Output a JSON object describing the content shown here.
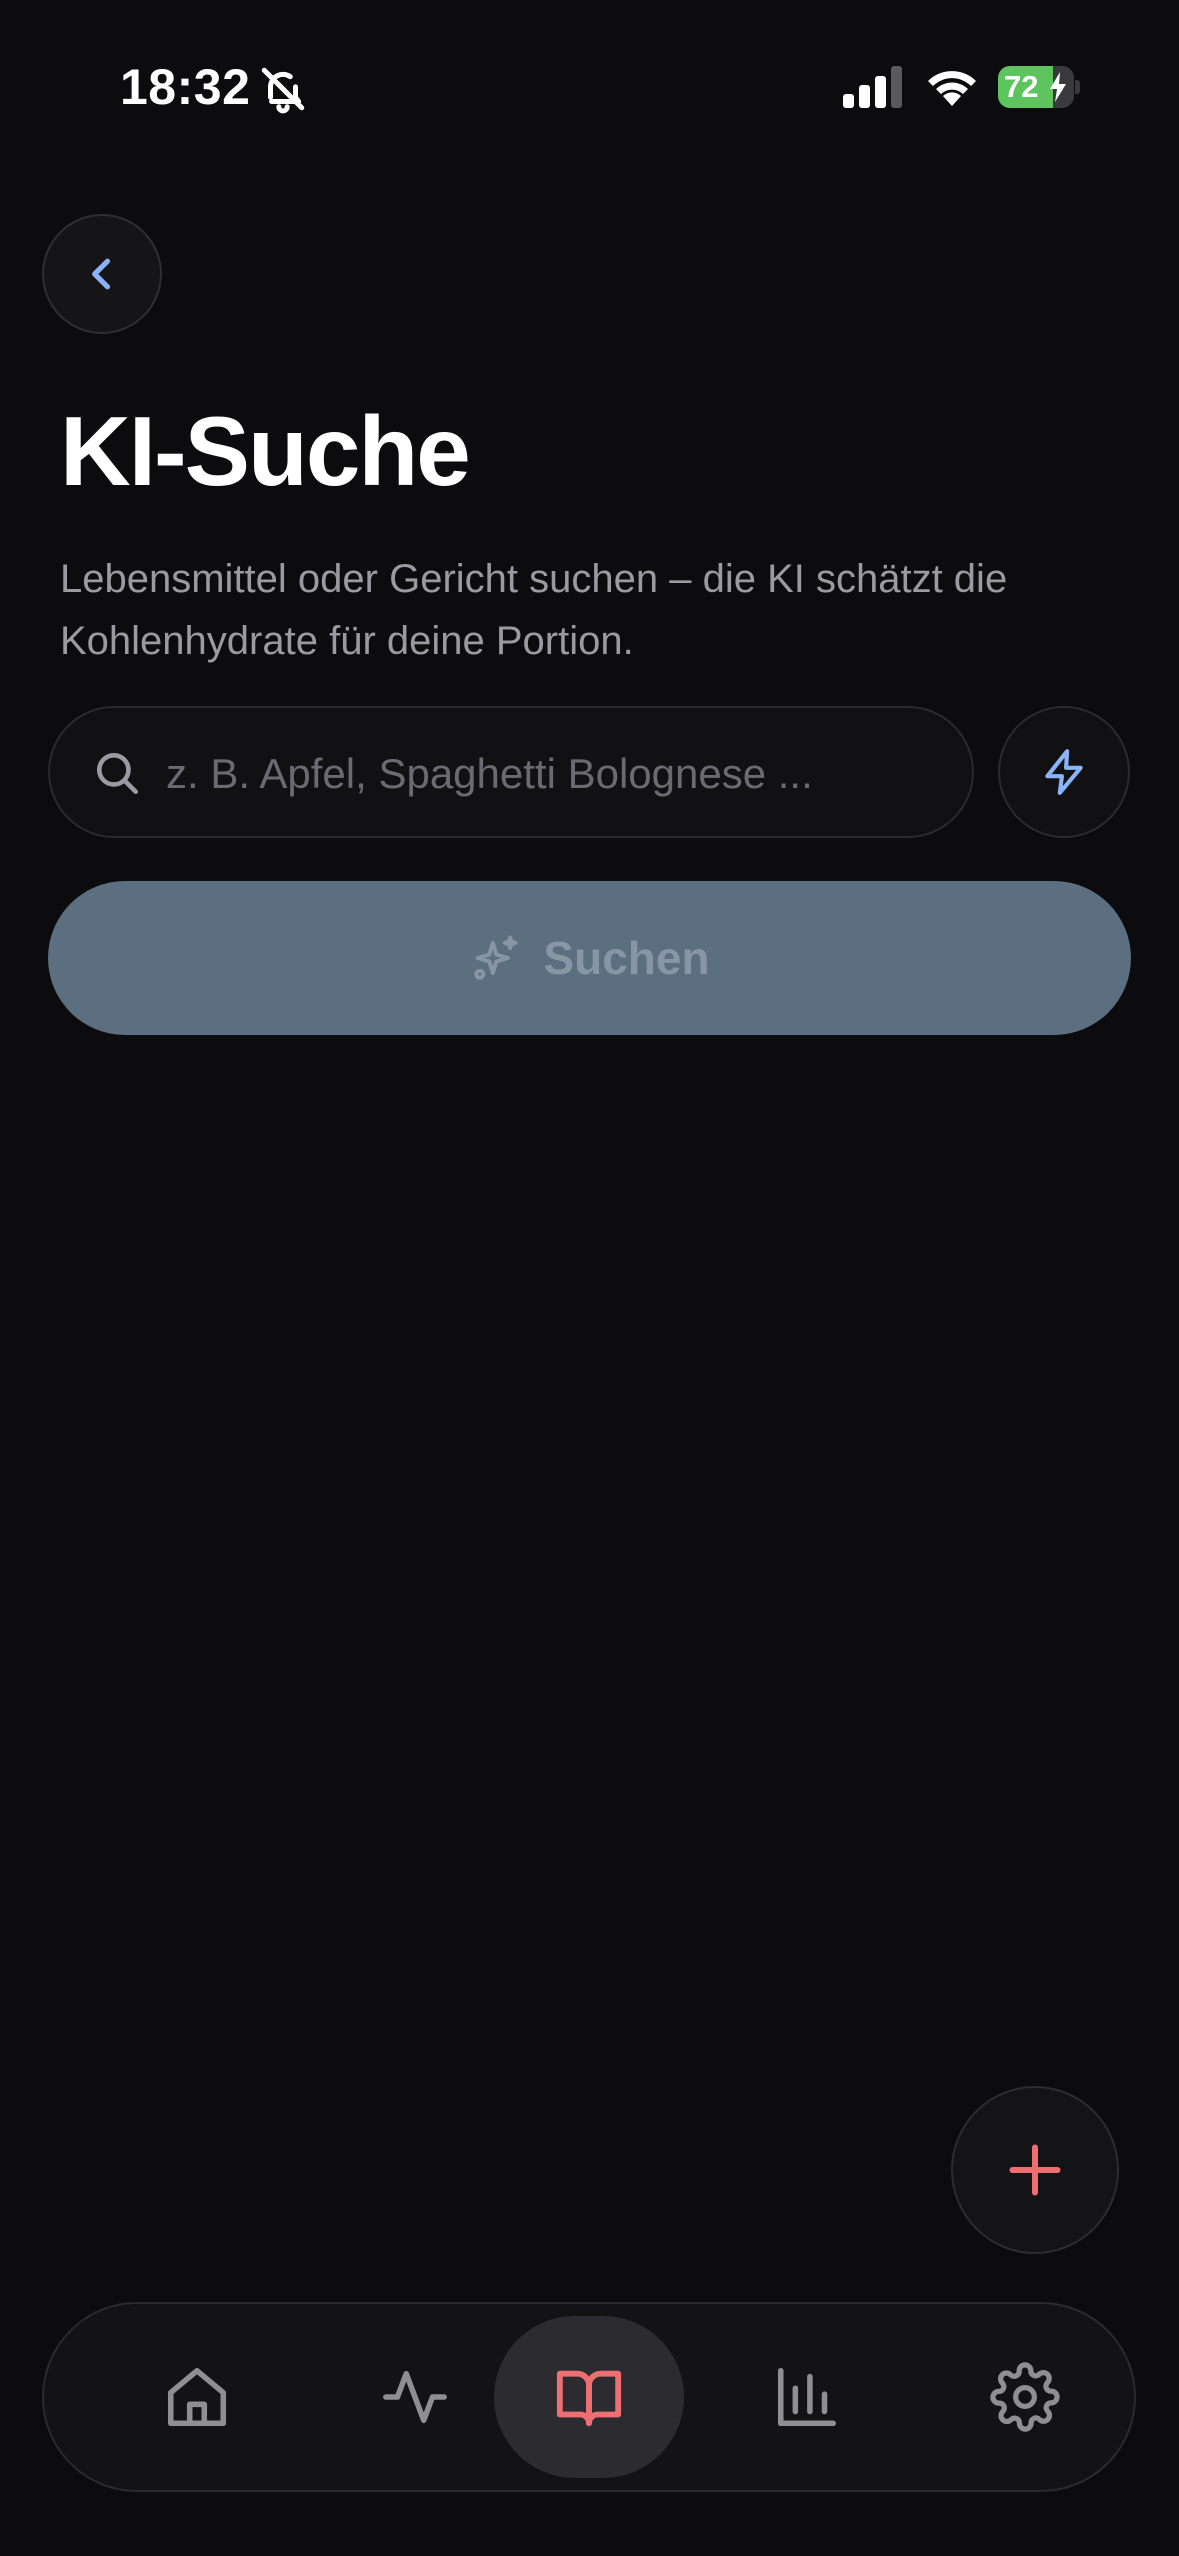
{
  "status_bar": {
    "time": "18:32",
    "battery_percent": "72",
    "battery_level": 0.72,
    "icons": [
      "bell-slash-icon",
      "cellular-signal-icon",
      "wifi-icon",
      "battery-icon",
      "charging-bolt-icon"
    ]
  },
  "header": {
    "back_icon": "chevron-left-icon",
    "title": "KI-Suche",
    "subtitle": "Lebensmittel oder Gericht suchen – die KI schätzt die Kohlenhydrate für deine Portion."
  },
  "search": {
    "value": "",
    "placeholder": "z. B. Apfel, Spaghetti Bolognese ...",
    "icon": "search-icon",
    "quick_icon": "lightning-icon"
  },
  "submit": {
    "label": "Suchen",
    "icon": "sparkles-icon",
    "enabled": false
  },
  "fab": {
    "icon": "plus-icon"
  },
  "tab_bar": {
    "active_index": 2,
    "items": [
      {
        "icon": "home-icon"
      },
      {
        "icon": "activity-icon"
      },
      {
        "icon": "book-open-icon"
      },
      {
        "icon": "bar-chart-icon"
      },
      {
        "icon": "settings-gear-icon"
      }
    ]
  },
  "colors": {
    "background": "#0c0c0e",
    "accent": "#ee6f72",
    "icon_blue": "#8ab4f8",
    "battery_green": "#5ec45e",
    "disabled_button": "#5b6f80"
  }
}
